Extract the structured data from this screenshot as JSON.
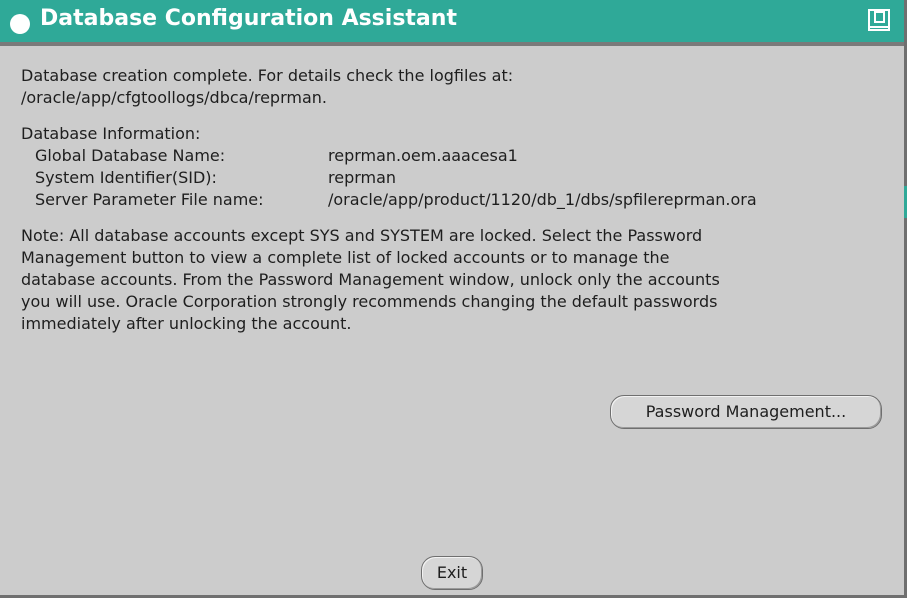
{
  "window": {
    "title": "Database Configuration Assistant"
  },
  "completion": {
    "line1": "Database creation complete. For details check the logfiles at:",
    "line2": " /oracle/app/cfgtoollogs/dbca/reprman."
  },
  "info": {
    "heading": "Database Information:",
    "rows": [
      {
        "label": "Global Database Name:",
        "value": "reprman.oem.aaacesa1"
      },
      {
        "label": "System Identifier(SID):",
        "value": "reprman"
      },
      {
        "label": "Server Parameter File name:",
        "value": "/oracle/app/product/1120/db_1/dbs/spfilereprman.ora"
      }
    ]
  },
  "note": {
    "lines": [
      "Note: All database accounts except SYS and SYSTEM are locked. Select the Password",
      "Management button to view a complete list of locked accounts or to manage the",
      "database accounts. From the Password Management window, unlock only the accounts",
      "you will use. Oracle Corporation strongly recommends changing the default passwords",
      "immediately after unlocking the account."
    ]
  },
  "buttons": {
    "password_management": "Password Management...",
    "exit": "Exit"
  },
  "icons": {
    "title_left": "window-menu-icon",
    "title_right": "maximize-icon"
  },
  "colors": {
    "titlebar": "#2fa998",
    "background": "#cccccc"
  }
}
